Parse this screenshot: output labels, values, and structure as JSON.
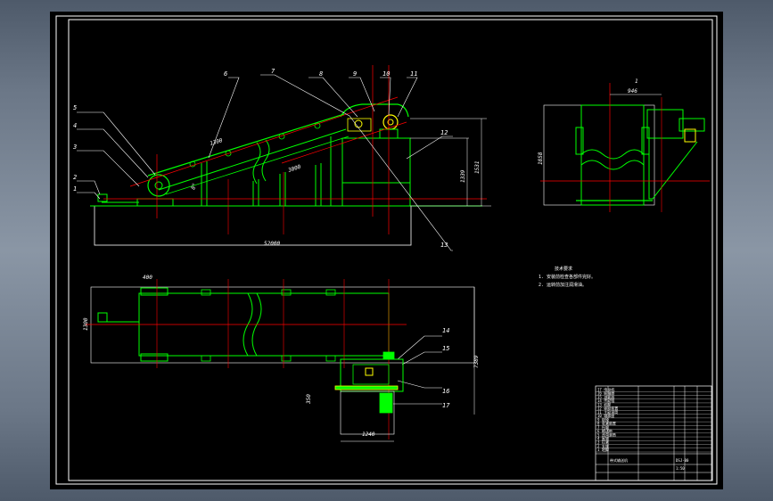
{
  "balloons": [
    "1",
    "2",
    "3",
    "4",
    "5",
    "6",
    "7",
    "7",
    "8",
    "9",
    "10",
    "11",
    "12",
    "13",
    "14",
    "15",
    "16",
    "17"
  ],
  "dimensions": {
    "overall_length": "52000",
    "incline_length": "1300",
    "angle_mark": "8°",
    "roller_span": "3000",
    "elev_height_a": "1339",
    "elev_height_b": "1531",
    "side_width": "946",
    "side_height": "1858",
    "plan_feed": "400",
    "plan_width": "1300",
    "plan_total": "7389",
    "drive_offset": "350",
    "drive_width": "1240",
    "side_top": "1"
  },
  "tech_requirements": {
    "title": "技术要求",
    "lines": [
      "1. 安装前检查各部件完好。",
      "2. 运转前加注润滑油。"
    ]
  },
  "title_block": {
    "rows": [
      "17 电动机",
      "16 联轴器",
      "15 减速器",
      "14 传动链",
      "13 机架",
      "12 驱动装置",
      "11 主动滚筒",
      "10 轴承座",
      "9 链轮",
      "8 张紧装置",
      "7 托辊",
      "6 输送带",
      "5 改向滚筒",
      "4 尾架",
      "3 拉紧",
      "2 支座",
      "1 地脚"
    ],
    "drawing_name": "带式输送机",
    "drawing_no": "DSJ-00",
    "scale": "1:50"
  },
  "colors": {
    "frame": "#ffffff",
    "structure": "#00ff00",
    "centerline": "#ff0000",
    "highlight": "#ffff00",
    "leader": "#ffffff"
  }
}
